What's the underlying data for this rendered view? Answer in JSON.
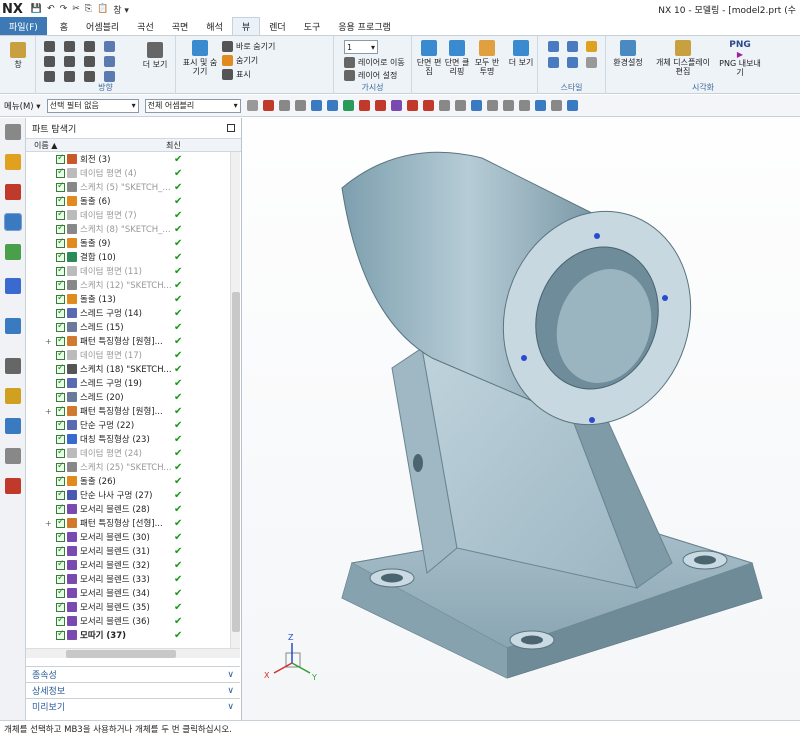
{
  "app": {
    "logo": "NX",
    "window_title": "NX 10 - 모델링 - [model2.prt (수"
  },
  "quick_access": {
    "window_menu": "창 ▾"
  },
  "tabs": [
    {
      "label": "파일(F)"
    },
    {
      "label": "홈"
    },
    {
      "label": "어셈블리"
    },
    {
      "label": "곡선"
    },
    {
      "label": "곡면"
    },
    {
      "label": "해석"
    },
    {
      "label": "뷰"
    },
    {
      "label": "렌더"
    },
    {
      "label": "도구"
    },
    {
      "label": "응용 프로그램"
    }
  ],
  "ribbon": {
    "window": "창",
    "orient_label": "방향",
    "more1": "더 보기",
    "display_hide": "표시 및 숨기기",
    "show_hide": {
      "immediate_hide": "바로 숨기기",
      "hide": "숨기기",
      "show": "표시"
    },
    "layer_num": "1",
    "layer_move": "레이어로 이동",
    "layer_settings": "레이어 설정",
    "visibility_label": "가시성",
    "section_edit": "단면 편집",
    "section_clip": "단면 클리핑",
    "all_invert": "모두 반투명",
    "more2": "더 보기",
    "style_label": "스타일",
    "env_settings": "환경설정",
    "object_display_edit": "개체 디스플레이 편집",
    "png_export": "PNG 내보내기",
    "png_icon": "PNG",
    "visualize_label": "시각화"
  },
  "toolbar": {
    "menu": "메뉴(M) ▾",
    "filter": "선택 필터 없음",
    "scope": "전체 어셈블리"
  },
  "navigator": {
    "title": "파트 탐색기",
    "col_name": "이름",
    "col_latest": "최신",
    "items": [
      {
        "label": "회전 (3)",
        "dim": false,
        "plus": false,
        "color": "#c85a2a"
      },
      {
        "label": "데이텀 평면 (4)",
        "dim": true,
        "plus": false,
        "color": "#bbbbbb"
      },
      {
        "label": "스케치 (5) \"SKETCH_...",
        "dim": true,
        "plus": false,
        "color": "#888888"
      },
      {
        "label": "돌출 (6)",
        "dim": false,
        "plus": false,
        "color": "#e08a20"
      },
      {
        "label": "데이텀 평면 (7)",
        "dim": true,
        "plus": false,
        "color": "#bbbbbb"
      },
      {
        "label": "스케치 (8) \"SKETCH_...",
        "dim": true,
        "plus": false,
        "color": "#888888"
      },
      {
        "label": "돌출 (9)",
        "dim": false,
        "plus": false,
        "color": "#e08a20"
      },
      {
        "label": "결합 (10)",
        "dim": false,
        "plus": false,
        "color": "#2a8a5a"
      },
      {
        "label": "데이텀 평면 (11)",
        "dim": true,
        "plus": false,
        "color": "#bbbbbb"
      },
      {
        "label": "스케치 (12) \"SKETCH...",
        "dim": true,
        "plus": false,
        "color": "#888888"
      },
      {
        "label": "돌출 (13)",
        "dim": false,
        "plus": false,
        "color": "#e08a20"
      },
      {
        "label": "스레드 구멍 (14)",
        "dim": false,
        "plus": false,
        "color": "#5a6ab0"
      },
      {
        "label": "스레드 (15)",
        "dim": false,
        "plus": false,
        "color": "#6a7a9a"
      },
      {
        "label": "패턴 특징형상 [원형]...",
        "dim": false,
        "plus": true,
        "color": "#d07a30"
      },
      {
        "label": "데이텀 평면 (17)",
        "dim": true,
        "plus": false,
        "color": "#bbbbbb"
      },
      {
        "label": "스케치 (18) \"SKETCH...",
        "dim": false,
        "plus": false,
        "color": "#555555"
      },
      {
        "label": "스레드 구멍 (19)",
        "dim": false,
        "plus": false,
        "color": "#5a6ab0"
      },
      {
        "label": "스레드 (20)",
        "dim": false,
        "plus": false,
        "color": "#6a7a9a"
      },
      {
        "label": "패턴 특징형상 [원형]...",
        "dim": false,
        "plus": true,
        "color": "#d07a30"
      },
      {
        "label": "단순 구멍 (22)",
        "dim": false,
        "plus": false,
        "color": "#5a6ab0"
      },
      {
        "label": "대칭 특징형상 (23)",
        "dim": false,
        "plus": false,
        "color": "#3a6ad0"
      },
      {
        "label": "데이텀 평면 (24)",
        "dim": true,
        "plus": false,
        "color": "#bbbbbb"
      },
      {
        "label": "스케치 (25) \"SKETCH...",
        "dim": true,
        "plus": false,
        "color": "#888888"
      },
      {
        "label": "돌출 (26)",
        "dim": false,
        "plus": false,
        "color": "#e08a20"
      },
      {
        "label": "단순 나사 구멍 (27)",
        "dim": false,
        "plus": false,
        "color": "#4a5ab0"
      },
      {
        "label": "모서리 블렌드 (28)",
        "dim": false,
        "plus": false,
        "color": "#7a4ab0"
      },
      {
        "label": "패턴 특징형상 [선형]...",
        "dim": false,
        "plus": true,
        "color": "#d07a30"
      },
      {
        "label": "모서리 블렌드 (30)",
        "dim": false,
        "plus": false,
        "color": "#7a4ab0"
      },
      {
        "label": "모서리 블렌드 (31)",
        "dim": false,
        "plus": false,
        "color": "#7a4ab0"
      },
      {
        "label": "모서리 블렌드 (32)",
        "dim": false,
        "plus": false,
        "color": "#7a4ab0"
      },
      {
        "label": "모서리 블렌드 (33)",
        "dim": false,
        "plus": false,
        "color": "#7a4ab0"
      },
      {
        "label": "모서리 블렌드 (34)",
        "dim": false,
        "plus": false,
        "color": "#7a4ab0"
      },
      {
        "label": "모서리 블렌드 (35)",
        "dim": false,
        "plus": false,
        "color": "#7a4ab0"
      },
      {
        "label": "모서리 블렌드 (36)",
        "dim": false,
        "plus": false,
        "color": "#7a4ab0"
      },
      {
        "label": "모따기 (37)",
        "dim": false,
        "plus": false,
        "bold": true,
        "color": "#7a4ab0"
      }
    ],
    "latest_mark": "✔",
    "sections": {
      "dependencies": "종속성",
      "details": "상세정보",
      "preview": "미리보기"
    }
  },
  "triad": {
    "x": "X",
    "y": "Y",
    "z": "Z"
  },
  "status_text": "개체를 선택하고 MB3을 사용하거나 개체를 두 번 클릭하십시오."
}
